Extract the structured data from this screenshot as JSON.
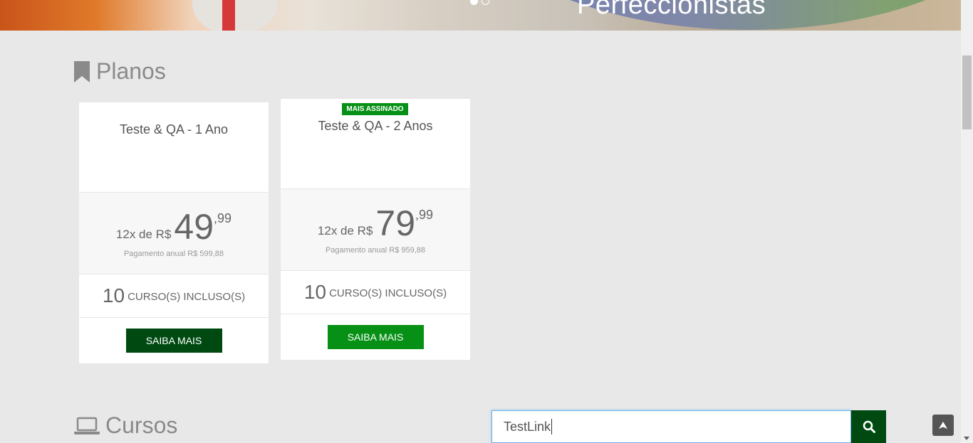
{
  "hero": {
    "title": "Perfeccionistas",
    "carousel_dots": [
      "active",
      "idle"
    ]
  },
  "planos": {
    "heading": "Planos",
    "icon": "bookmark-icon",
    "cards": [
      {
        "name": "Teste & QA - 1 Ano",
        "price_prefix": "12x de R$",
        "price_integer": "49",
        "price_cents": ",99",
        "annual": "Pagamento anual R$ 599,88",
        "courses_count": "10",
        "courses_label": "CURSO(S) INCLUSO(S)",
        "button_label": "SAIBA MAIS",
        "button_color": "#004a12"
      },
      {
        "badge": "MAIS ASSINADO",
        "name": "Teste & QA - 2 Anos",
        "price_prefix": "12x de R$",
        "price_integer": "79",
        "price_cents": ",99",
        "annual": "Pagamento anual R$ 959,88",
        "courses_count": "10",
        "courses_label": "CURSO(S) INCLUSO(S)",
        "button_label": "SAIBA MAIS",
        "button_color": "#079016"
      }
    ]
  },
  "cursos": {
    "heading": "Cursos",
    "icon": "laptop-icon"
  },
  "search": {
    "value": "TestLink",
    "icon": "search-icon"
  },
  "colors": {
    "brand_dark_green": "#004a12",
    "brand_green": "#079016",
    "background": "#e8e8e8"
  }
}
